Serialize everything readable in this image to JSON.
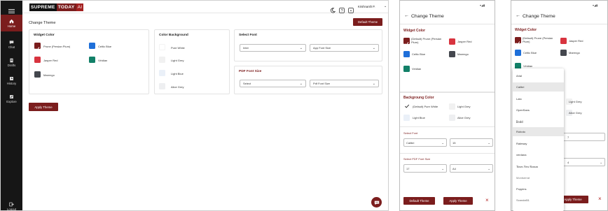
{
  "desktop": {
    "logo": {
      "part1": "SUPREME",
      "part2": "TODAY",
      "part3": "AI"
    },
    "user_name": "Krishnanth P.",
    "sidebar": [
      {
        "label": "Home",
        "icon": "home-icon"
      },
      {
        "label": "Chat",
        "icon": "chat-icon"
      },
      {
        "label": "Drafts",
        "icon": "drafts-icon"
      },
      {
        "label": "History",
        "icon": "history-icon"
      },
      {
        "label": "Explore",
        "icon": "explore-icon"
      },
      {
        "label": "Logout",
        "icon": "logout-icon"
      }
    ],
    "page_title": "Change Theme",
    "default_theme_label": "Default Theme",
    "apply_theme_label": "Apply Theme",
    "widget_color": {
      "title": "Widget Color",
      "items": [
        {
          "label": "Prune (Persian Plum)",
          "color": "#7b1d1d",
          "selected": true
        },
        {
          "label": "Celtic Blue",
          "color": "#1e6fd9"
        },
        {
          "label": "Jasper Red",
          "color": "#d8343f"
        },
        {
          "label": "Viridian",
          "color": "#128068"
        },
        {
          "label": "Marengo",
          "color": "#44474e"
        }
      ]
    },
    "color_background": {
      "title": "Color Background",
      "items": [
        {
          "label": "Pure White",
          "color": "#ffffff"
        },
        {
          "label": "Light Grey",
          "color": "#f1f1f1"
        },
        {
          "label": "Light Blue",
          "color": "#eaf0f8"
        },
        {
          "label": "Alice Grey",
          "color": "#eeeff1"
        }
      ]
    },
    "select_font": {
      "title": "Select Font",
      "font_value": "Inter",
      "size_value": "App Font Size"
    },
    "pdf_font": {
      "title": "PDF Font Size",
      "font_value": "Select",
      "size_value": "Pdf Font Size"
    }
  },
  "mobile1": {
    "title": "Change Theme",
    "widget_title": "Widget Color",
    "widget_items": [
      {
        "label": "(Default) Prune (Persian Plum)",
        "color": "#7b1d1d",
        "selected": true
      },
      {
        "label": "Jasper Red",
        "color": "#d8343f"
      },
      {
        "label": "Celtic Blue",
        "color": "#1e6fd9"
      },
      {
        "label": "Marengo",
        "color": "#44474e"
      },
      {
        "label": "Viridian",
        "color": "#128068"
      }
    ],
    "bg_title": "Backgroung Color",
    "bg_items": [
      {
        "label": "(Default) Pure White",
        "color": "#ffffff",
        "selected": true
      },
      {
        "label": "Light Grey",
        "color": "#f1f1f1"
      },
      {
        "label": "Light Blue",
        "color": "#eaf0f8"
      },
      {
        "label": "Alice Grey",
        "color": "#eeeff1"
      }
    ],
    "font_title": "Select Font",
    "font_value": "Calibri",
    "font_size": "15",
    "pdf_title": "Select PDF Font Size",
    "pdf_font": "17",
    "pdf_size": "A4",
    "default_theme_label": "Default Theme",
    "apply_theme_label": "Apply Theme"
  },
  "mobile2": {
    "title": "Change Theme",
    "widget_title": "Widget Color",
    "widget_items": [
      {
        "label": "(Default) Prune (Persian Plum)",
        "color": "#7b1d1d",
        "selected": true
      },
      {
        "label": "Jasper Red",
        "color": "#d8343f"
      },
      {
        "label": "Celtic Blue",
        "color": "#1e6fd9"
      },
      {
        "label": "Marengo",
        "color": "#44474e"
      },
      {
        "label": "Viridian",
        "color": "#128068"
      }
    ],
    "behind_labels": {
      "light_grey": "Light Grey",
      "alice_grey": "Alice Grey",
      "select_value": "7",
      "pdf_value": "4"
    },
    "apply_theme_label": "Apply Theme",
    "dropdown": [
      "Arial",
      "Calibri",
      "Lato",
      "OpenSans",
      "Dodd",
      "Roboto",
      "Raleway",
      "verdana",
      "Times New Roman",
      "Montserrat",
      "Poppins",
      "Scandal51"
    ],
    "dropdown_highlight": [
      1,
      5
    ]
  }
}
